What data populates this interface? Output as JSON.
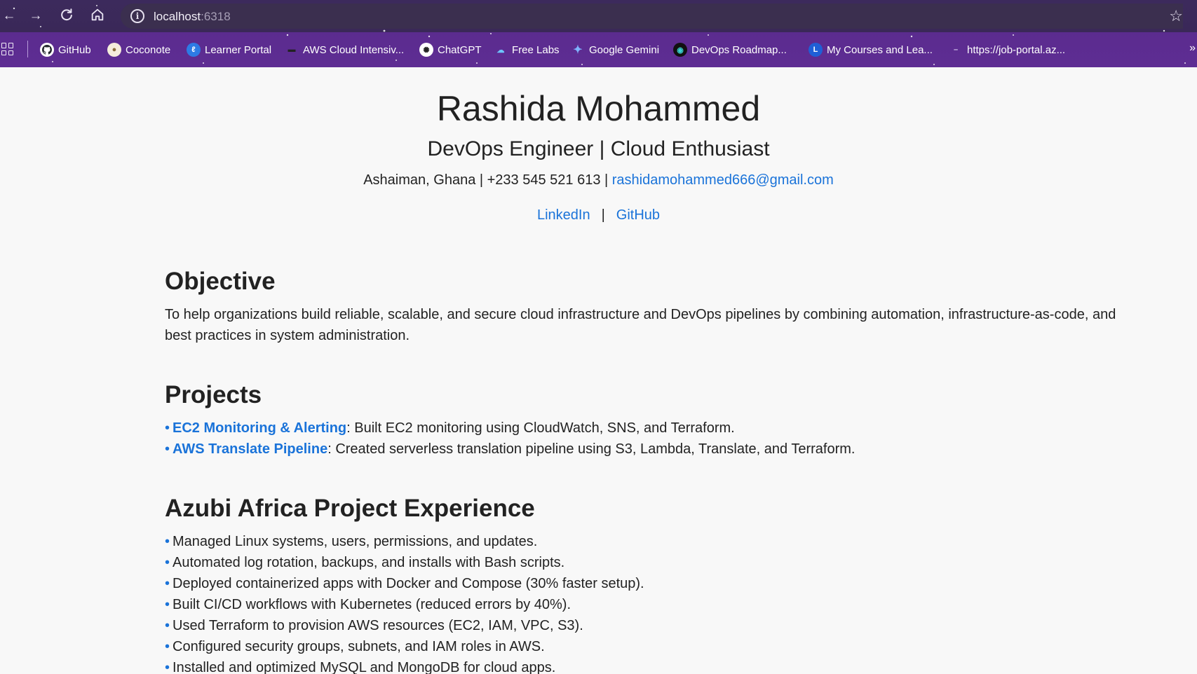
{
  "browser": {
    "url_host": "localhost",
    "url_port": ":6318",
    "bookmarks": [
      {
        "label": "GitHub",
        "icon": "github-icon"
      },
      {
        "label": "Coconote",
        "icon": "coconote-icon"
      },
      {
        "label": "Learner Portal",
        "icon": "learner-portal-icon"
      },
      {
        "label": "AWS Cloud Intensiv...",
        "icon": "aws-icon"
      },
      {
        "label": "ChatGPT",
        "icon": "chatgpt-icon"
      },
      {
        "label": "Free Labs",
        "icon": "free-labs-icon"
      },
      {
        "label": "Google Gemini",
        "icon": "gemini-icon"
      },
      {
        "label": "DevOps Roadmap...",
        "icon": "devops-roadmap-icon"
      },
      {
        "label": "My Courses and Lea...",
        "icon": "courses-icon"
      },
      {
        "label": "https://job-portal.az...",
        "icon": "job-portal-icon"
      }
    ],
    "colors": {
      "chrome_top": "#3c2a5c",
      "bookmark_bar": "#5e2d93"
    }
  },
  "header": {
    "name": "Rashida Mohammed",
    "title": "DevOps Engineer | Cloud Enthusiast",
    "location_phone": "Ashaiman, Ghana | +233 545 521 613 |",
    "email": "rashidamohammed666@gmail.com",
    "linkedin": "LinkedIn",
    "separator": "|",
    "github": "GitHub"
  },
  "objective": {
    "heading": "Objective",
    "text": "To help organizations build reliable, scalable, and secure cloud infrastructure and DevOps pipelines by combining automation, infrastructure-as-code, and best practices in system administration."
  },
  "projects": {
    "heading": "Projects",
    "items": [
      {
        "name": "EC2 Monitoring & Alerting",
        "desc": ": Built EC2 monitoring using CloudWatch, SNS, and Terraform."
      },
      {
        "name": "AWS Translate Pipeline",
        "desc": ": Created serverless translation pipeline using S3, Lambda, Translate, and Terraform."
      }
    ]
  },
  "experience": {
    "heading": "Azubi Africa Project Experience",
    "items": [
      "Managed Linux systems, users, permissions, and updates.",
      "Automated log rotation, backups, and installs with Bash scripts.",
      "Deployed containerized apps with Docker and Compose (30% faster setup).",
      "Built CI/CD workflows with Kubernetes (reduced errors by 40%).",
      "Used Terraform to provision AWS resources (EC2, IAM, VPC, S3).",
      "Configured security groups, subnets, and IAM roles in AWS.",
      "Installed and optimized MySQL and MongoDB for cloud apps."
    ]
  },
  "bullet_char": "•",
  "accent_color": "#1a73d9"
}
